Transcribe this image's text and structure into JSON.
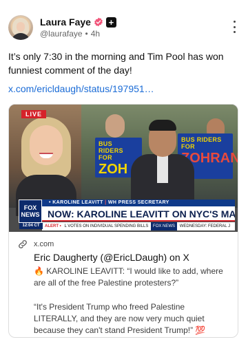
{
  "author": {
    "display_name": "Laura Faye",
    "handle": "@laurafaye",
    "separator": "•",
    "time_ago": "4h"
  },
  "badges": {
    "plus_label": "+"
  },
  "post": {
    "text": "It’s only 7:30 in the morning and Tim Pool has won funniest comment of the day!",
    "link_text": "x.com/ericldaugh/status/197951…"
  },
  "video": {
    "live_label": "LIVE",
    "network_logo": "FOX NEWS",
    "time_label": "12:04 CT",
    "super_tag": {
      "name": "KAROLINE LEAVITT",
      "role": "WH PRESS SECRETARY",
      "prefix": "•"
    },
    "headline": "NOW: KAROLINE LEAVITT ON NYC'S MAMDANI",
    "ticker": {
      "alert": "ALERT •",
      "text1": "L VOTES ON INDIVIDUAL SPENDING BILLS",
      "network": "FOX NEWS",
      "text2": "WEDNESDAY: FEDERAL J"
    },
    "sign_left": {
      "small": "BUS RIDERS FOR",
      "big": "ZOH"
    },
    "sign_right": {
      "small": "BUS RIDERS FOR",
      "big": "ZOHRAN"
    },
    "colors": {
      "sign_blue": "#1a3f9e",
      "sign_yellow": "#f1d400",
      "fox_blue": "#0c2a6b",
      "live_red": "#d6222a"
    }
  },
  "card": {
    "domain": "x.com",
    "title": "Eric Daugherty (@EricLDaugh) on X",
    "desc_lines": [
      "🔥 KAROLINE LEAVITT: “I would like to add, where are all of the free Palestine protesters?”",
      "“It's President Trump who freed Palestine LITERALLY, and they are now very much quiet because they can't stand President Trump!” 💯"
    ]
  },
  "icons": {
    "verified": "verified-badge-icon",
    "more": "more-vertical-icon",
    "link": "link-icon"
  }
}
